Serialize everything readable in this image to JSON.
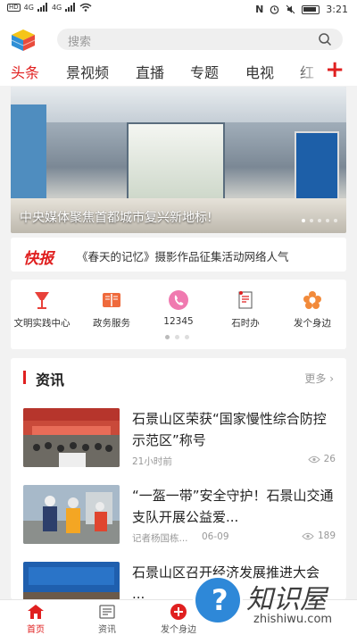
{
  "status": {
    "left_badges": [
      "HD",
      "HD"
    ],
    "signal": "4G",
    "signal2": "4G",
    "time": "3:21"
  },
  "search": {
    "placeholder": "搜索"
  },
  "tabs": {
    "items": [
      "头条",
      "景视频",
      "直播",
      "专题",
      "电视",
      "红"
    ],
    "active_index": 0
  },
  "banner": {
    "caption": "中央媒体聚焦首都城市复兴新地标!",
    "slide_count": 5,
    "active_slide": 0
  },
  "kuaibao": {
    "tag": "快报",
    "text": "《春天的记忆》摄影作品征集活动网络人气"
  },
  "services": {
    "items": [
      {
        "label": "文明实践中心",
        "icon": "trophy-icon"
      },
      {
        "label": "政务服务",
        "icon": "book-icon"
      },
      {
        "label": "12345",
        "icon": "phone-icon"
      },
      {
        "label": "石时办",
        "icon": "document-icon"
      },
      {
        "label": "发个身边",
        "icon": "flower-icon"
      }
    ],
    "page_count": 3,
    "active_page": 0
  },
  "news": {
    "title": "资讯",
    "more": "更多",
    "items": [
      {
        "title": "石景山区荣获“国家慢性综合防控示范区”称号",
        "time": "21小时前",
        "source": "",
        "views": "26"
      },
      {
        "title": "“一盔一带”安全守护！石景山交通支队开展公益爱...",
        "time": "06-09",
        "source": "记者杨国栋...",
        "views": "189"
      },
      {
        "title": "石景山区召开经济发展推进大会 ...",
        "time": "",
        "source": "",
        "views": ""
      }
    ]
  },
  "bottom_nav": {
    "items": [
      "首页",
      "资讯",
      "发个身边",
      "",
      ""
    ],
    "active_index": 0
  },
  "watermark": {
    "text": "知识屋",
    "url": "zhishiwu.com"
  },
  "colors": {
    "accent": "#e02020"
  }
}
